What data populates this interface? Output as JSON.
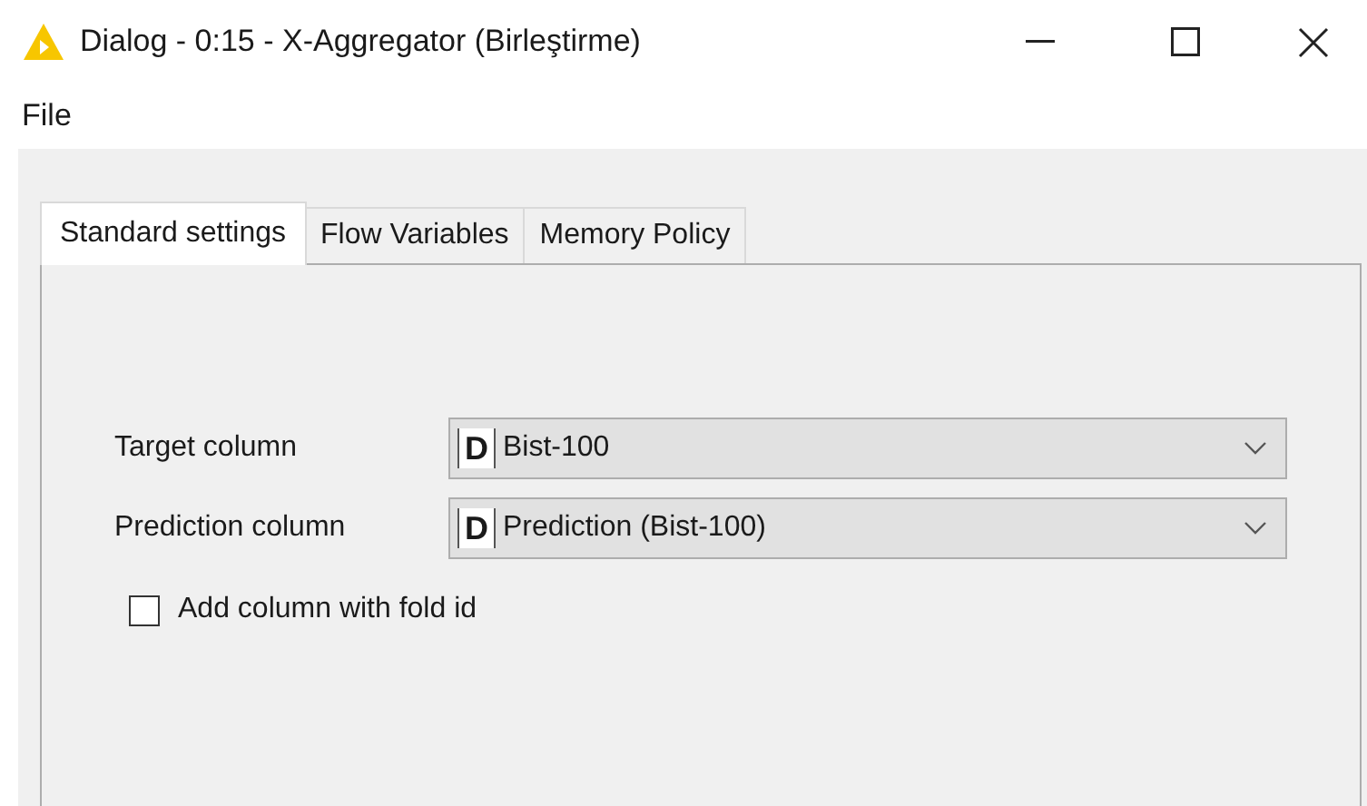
{
  "window": {
    "title": "Dialog - 0:15 - X-Aggregator (Birleştirme)"
  },
  "menu": [
    "File"
  ],
  "tabs": [
    {
      "label": "Standard settings",
      "selected": true
    },
    {
      "label": "Flow Variables",
      "selected": false
    },
    {
      "label": "Memory Policy",
      "selected": false
    }
  ],
  "fields": [
    {
      "label": "Target column",
      "type_badge": "D",
      "value": "Bist-100"
    },
    {
      "label": "Prediction column",
      "type_badge": "D",
      "value": "Prediction (Bist-100)"
    }
  ],
  "checkbox": {
    "label": "Add column with fold id",
    "checked": false
  }
}
